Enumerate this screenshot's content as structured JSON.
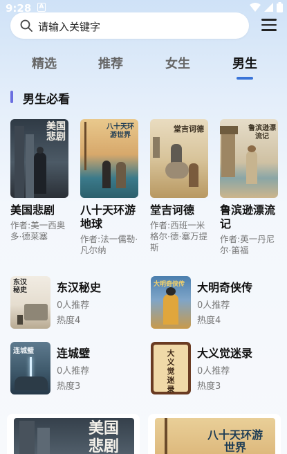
{
  "status": {
    "time": "9:28",
    "notice": "A"
  },
  "search": {
    "placeholder": "请输入关键字"
  },
  "tabs": [
    {
      "label": "精选"
    },
    {
      "label": "推荐"
    },
    {
      "label": "女生"
    },
    {
      "label": "男生"
    }
  ],
  "active_tab": "男生",
  "section": {
    "title": "男生必看"
  },
  "featured": [
    {
      "title": "美国悲剧",
      "author": "作者:美一西奥多·德莱塞",
      "cover_text": "美国悲剧"
    },
    {
      "title": "八十天环游地球",
      "author": "作者:法一儒勒·凡尔纳",
      "cover_text": "八十天环游世界"
    },
    {
      "title": "堂吉诃德",
      "author": "作者:西班一米格尔·德·塞万提斯",
      "cover_text": "堂吉诃德"
    },
    {
      "title": "鲁滨逊漂流记",
      "author": "作者:英一丹尼尔·笛福",
      "cover_text": "鲁滨逊漂流记"
    }
  ],
  "list": [
    {
      "title": "东汉秘史",
      "rec": "0人推荐",
      "hot": "热度4",
      "cover_text": "东汉秘史"
    },
    {
      "title": "大明奇侠传",
      "rec": "0人推荐",
      "hot": "热度4",
      "cover_text": "大明奇侠传"
    },
    {
      "title": "连城璧",
      "rec": "0人推荐",
      "hot": "热度3",
      "cover_text": "连城璧"
    },
    {
      "title": "大义觉迷录",
      "rec": "0人推荐",
      "hot": "热度3",
      "cover_text": "大义觉迷录"
    }
  ],
  "bottom_cards": [
    {
      "cover_text": "美国悲剧"
    },
    {
      "cover_text": "八十天环游世界"
    }
  ]
}
